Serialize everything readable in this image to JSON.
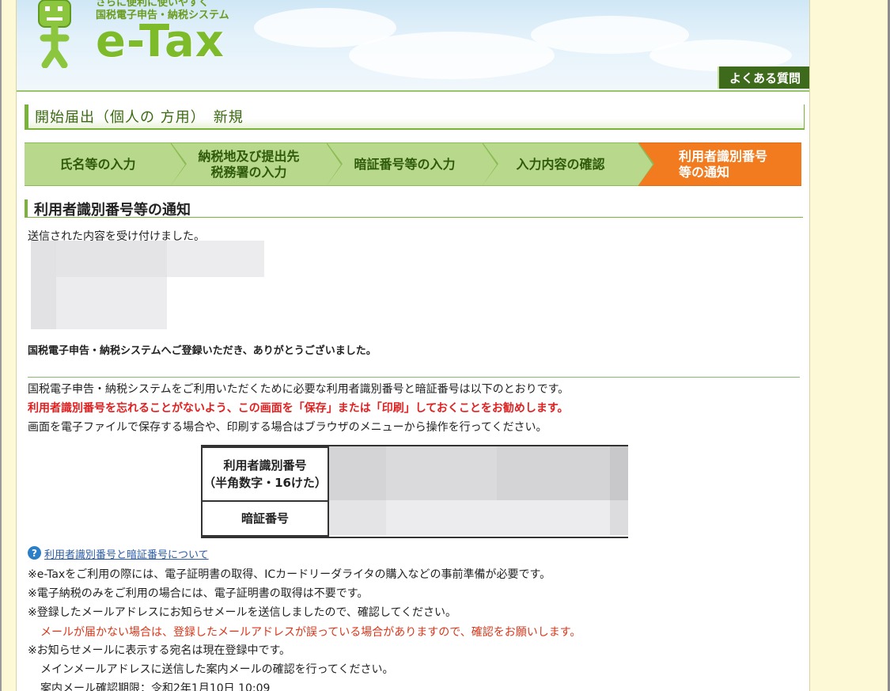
{
  "header": {
    "tagline_1": "さらに便利に使いやすく",
    "tagline_2": "国税電子申告・納税システム",
    "logo": "e-Tax",
    "faq_label": "よくある質問"
  },
  "page_title": "開始届出（個人の 方用）　新規",
  "steps": [
    {
      "label_1": "氏名等の入力",
      "label_2": ""
    },
    {
      "label_1": "納税地及び提出先",
      "label_2": "税務署の入力"
    },
    {
      "label_1": "暗証番号等の入力",
      "label_2": ""
    },
    {
      "label_1": "入力内容の確認",
      "label_2": ""
    },
    {
      "label_1": "利用者識別番号",
      "label_2": "等の通知"
    }
  ],
  "section": {
    "heading": "利用者識別番号等の通知",
    "received": "送信された内容を受け付けました。",
    "thanks": "国税電子申告・納税システムへご登録いただき、ありがとうございました。",
    "info_line": "国税電子申告・納税システムをご利用いただくために必要な利用者識別番号と暗証番号は以下のとおりです。",
    "warning": "利用者識別番号を忘れることがないよう、この画面を「保存」または「印刷」しておくことをお勧めします。",
    "save_note": "画面を電子ファイルで保存する場合や、印刷する場合はブラウザのメニューから操作を行ってください。"
  },
  "id_table": {
    "user_id_label_1": "利用者識別番号",
    "user_id_label_2": "（半角数字・16けた）",
    "pin_label": "暗証番号"
  },
  "help_link": "利用者識別番号と暗証番号について",
  "notes": {
    "n1": "※e-Taxをご利用の際には、電子証明書の取得、ICカードリーダライタの購入などの事前準備が必要です。",
    "n2": "※電子納税のみをご利用の場合には、電子証明書の取得は不要です。",
    "n3": "※登録したメールアドレスにお知らせメールを送信しましたので、確認してください。",
    "n3_warning": "メールが届かない場合は、登録したメールアドレスが誤っている場合がありますので、確認をお願いします。",
    "n4": "※お知らせメールに表示する宛名は現在登録中です。",
    "n4_detail": "メインメールアドレスに送信した案内メールの確認を行ってください。",
    "n4_deadline": "案内メール確認期限：令和2年1月10日 10:09"
  },
  "colors": {
    "accent_green": "#7ab339",
    "step_green": "#b8d98c",
    "step_active": "#f27b1f",
    "warning_red": "#e02020",
    "faq_bg": "#3e6a1c"
  }
}
